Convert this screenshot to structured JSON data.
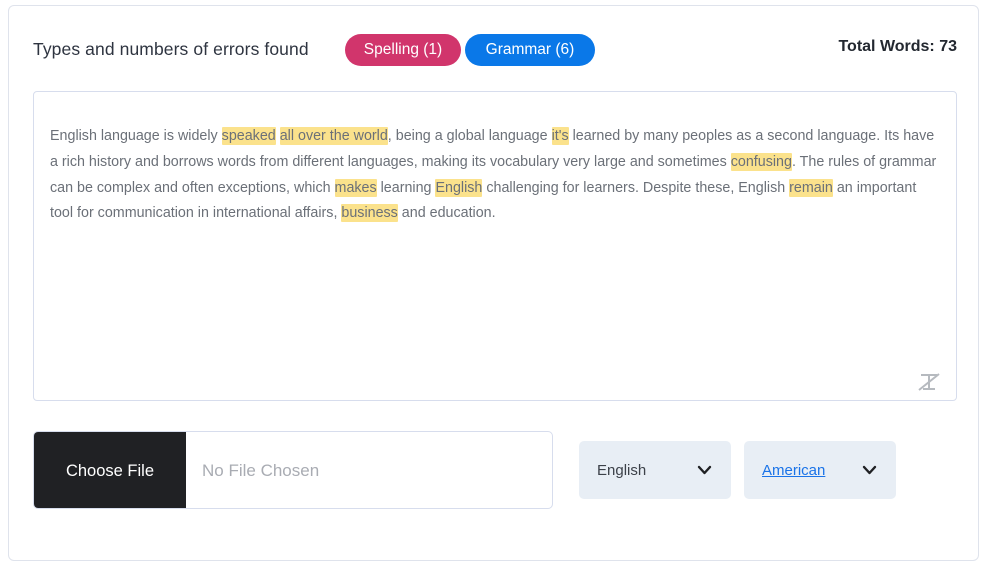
{
  "header": {
    "title": "Types and numbers of errors found",
    "badges": [
      {
        "label": "Spelling (1)",
        "name": "spelling-badge",
        "color": "#d1356c"
      },
      {
        "label": "Grammar (6)",
        "name": "grammar-badge",
        "color": "#0a78e8"
      }
    ],
    "total_words": "Total Words: 73"
  },
  "editor": {
    "segments": [
      {
        "text": "English language is widely ",
        "highlight": false
      },
      {
        "text": "speaked",
        "highlight": true
      },
      {
        "text": " ",
        "highlight": false
      },
      {
        "text": "all over the world",
        "highlight": true
      },
      {
        "text": ", being a global language ",
        "highlight": false
      },
      {
        "text": "it's",
        "highlight": true
      },
      {
        "text": " learned by many peoples as a second language. Its have a rich history and borrows words from different languages, making its vocabulary very large and sometimes ",
        "highlight": false
      },
      {
        "text": "confusing",
        "highlight": true
      },
      {
        "text": ". The rules of grammar can be complex and often exceptions, which ",
        "highlight": false
      },
      {
        "text": "makes",
        "highlight": true
      },
      {
        "text": " learning ",
        "highlight": false
      },
      {
        "text": "English",
        "highlight": true
      },
      {
        "text": " challenging for learners. Despite these, English ",
        "highlight": false
      },
      {
        "text": "remain",
        "highlight": true
      },
      {
        "text": " an important tool for communication in international affairs, ",
        "highlight": false
      },
      {
        "text": "business",
        "highlight": true
      },
      {
        "text": " and education.",
        "highlight": false
      }
    ],
    "highlight_color": "#fbe28c",
    "resize_icon": "text-strikethrough-resize-icon"
  },
  "controls": {
    "choose_file_label": "Choose File",
    "file_name_value": "No File Chosen",
    "language_select": {
      "value": "English",
      "icon": "chevron-down-icon"
    },
    "variant_select": {
      "value": "American",
      "icon": "chevron-down-icon"
    }
  }
}
